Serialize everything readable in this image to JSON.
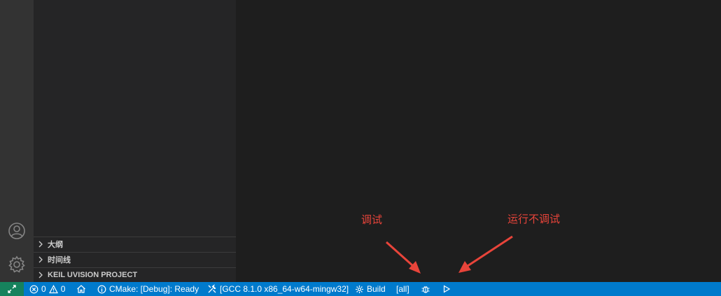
{
  "sidebar": {
    "sections": [
      {
        "label": "大纲"
      },
      {
        "label": "时间线"
      },
      {
        "label": "KEIL UVISION PROJECT"
      }
    ]
  },
  "activity_bar": {
    "icons": [
      "account-icon",
      "settings-gear-icon"
    ]
  },
  "statusbar": {
    "errors": "0",
    "warnings": "0",
    "cmake_status": "CMake: [Debug]: Ready",
    "kit": "[GCC 8.1.0 x86_64-w64-mingw32]",
    "build_label": "Build",
    "target": "[all]"
  },
  "annotations": {
    "debug": "调试",
    "run_without_debug": "运行不调试"
  },
  "colors": {
    "statusbar": "#007acc",
    "remote": "#16825d",
    "annotation": "#e8443a",
    "editor_bg": "#1e1e1e",
    "sidebar_bg": "#252526",
    "activity_bg": "#333333"
  }
}
